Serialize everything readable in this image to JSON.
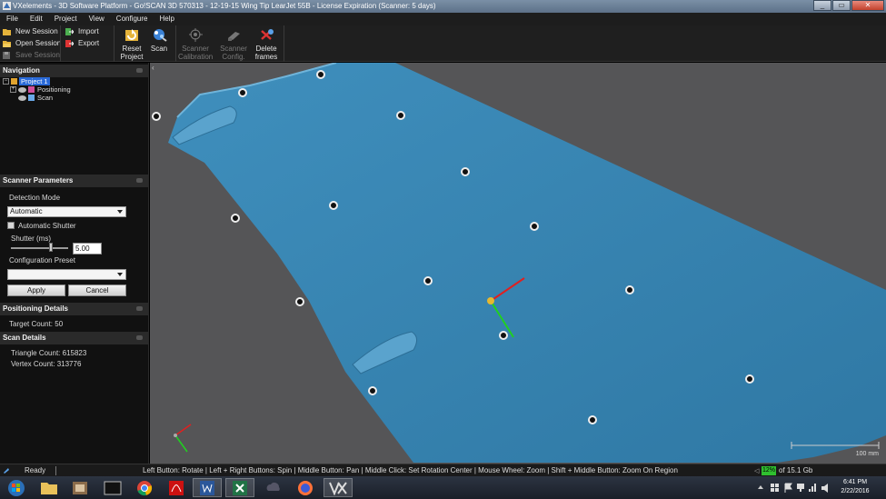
{
  "window": {
    "title": "VXelements - 3D Software Platform - Go!SCAN 3D 570313 - 12-19-15 Wing Tip LearJet 55B - License Expiration (Scanner: 5 days)",
    "buttons": {
      "minimize": "_",
      "maximize": "▭",
      "close": "✕"
    }
  },
  "menu": [
    "File",
    "Edit",
    "Project",
    "View",
    "Configure",
    "Help"
  ],
  "toolbar": {
    "session": {
      "new": "New Session",
      "open": "Open Session",
      "save": "Save Session"
    },
    "file": {
      "import": "Import",
      "export": "Export"
    },
    "reset": {
      "line1": "Reset",
      "line2": "Project"
    },
    "scan": {
      "line1": "Scan"
    },
    "calibration": {
      "line1": "Scanner",
      "line2": "Calibration"
    },
    "config": {
      "line1": "Scanner",
      "line2": "Config."
    },
    "delete": {
      "line1": "Delete",
      "line2": "frames"
    }
  },
  "navigation": {
    "title": "Navigation",
    "project": "Project 1",
    "positioning": "Positioning",
    "scan": "Scan"
  },
  "scanner_parameters": {
    "title": "Scanner Parameters",
    "detection_mode_label": "Detection Mode",
    "detection_mode_value": "Automatic",
    "auto_shutter_label": "Automatic Shutter",
    "shutter_label": "Shutter (ms)",
    "shutter_value": "5.00",
    "shutter_slider_fraction": 0.7,
    "config_preset_label": "Configuration Preset",
    "config_preset_value": "",
    "apply": "Apply",
    "cancel": "Cancel"
  },
  "positioning_details": {
    "title": "Positioning Details",
    "target_count": "Target Count: 50"
  },
  "scan_details": {
    "title": "Scan Details",
    "triangle_count": "Triangle Count: 615823",
    "vertex_count": "Vertex Count: 313776"
  },
  "viewport": {
    "scale_label": "100 mm",
    "surface_color": "#3a87b3",
    "background_color": "#555557"
  },
  "status": {
    "ready": "Ready",
    "hints": "Left Button: Rotate  |  Left + Right Buttons: Spin  |  Middle Button: Pan  |  Middle Click: Set Rotation Center  |  Mouse Wheel: Zoom  |  Shift + Middle Button: Zoom On Region",
    "memory_percent": "12%",
    "memory_text": "of 15.1 Gb"
  },
  "taskbar": {
    "time": "6:41 PM",
    "date": "2/22/2016"
  }
}
